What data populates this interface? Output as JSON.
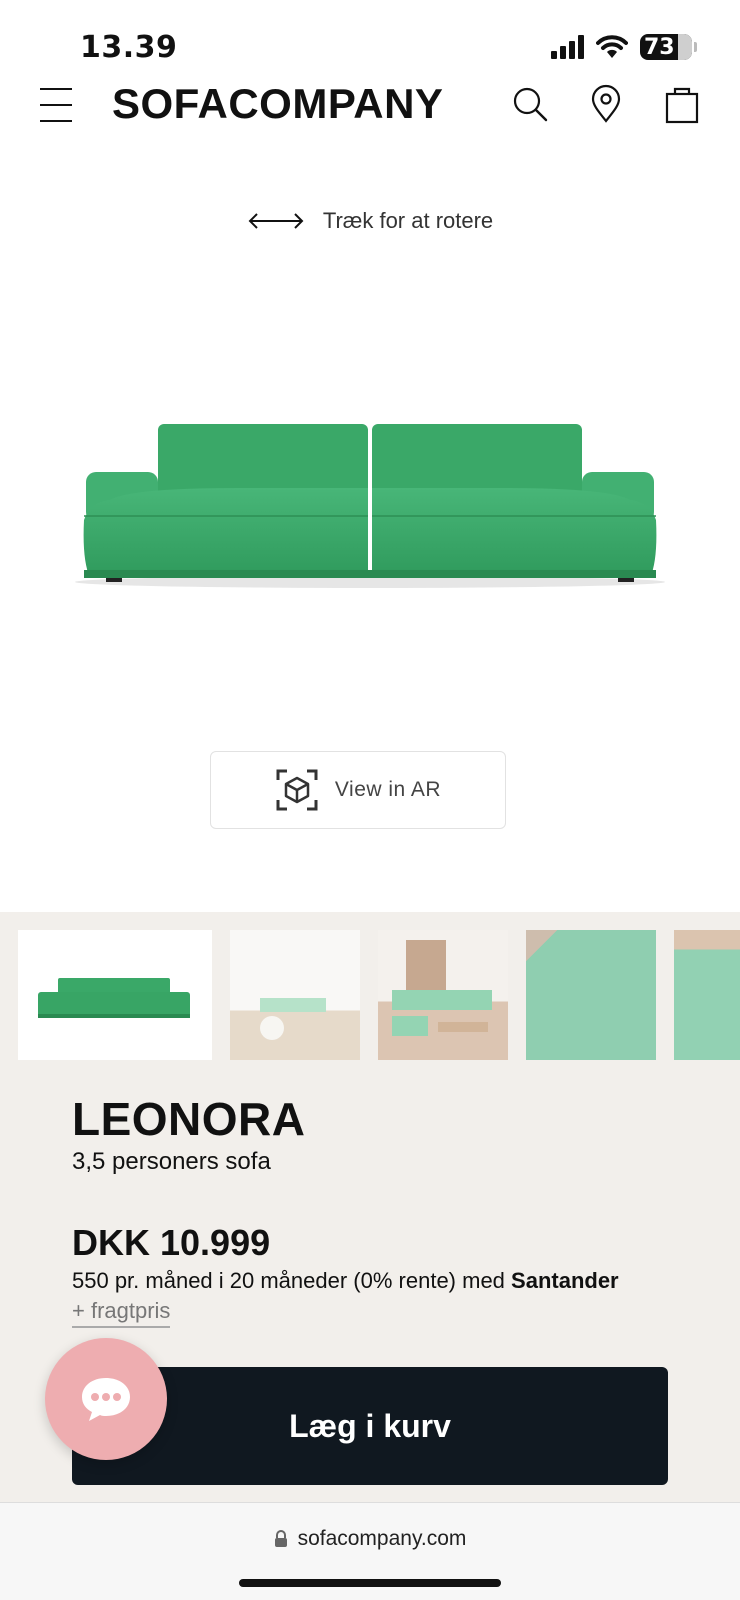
{
  "status_bar": {
    "time": "13.39",
    "battery": "73"
  },
  "header": {
    "logo": "SOFACOMPANY",
    "icons": [
      "menu-icon",
      "search-icon",
      "location-pin-icon",
      "shopping-bag-icon"
    ]
  },
  "viewer": {
    "rotate_hint": "Træk for at rotere",
    "ar_label": "View in AR",
    "sofa_color": "#3fae6e"
  },
  "gallery": {
    "thumbnails": [
      "Sofa front view",
      "Living room scene",
      "Room with shelves scene",
      "Fabric close-up",
      "Detail view"
    ]
  },
  "product": {
    "name": "LEONORA",
    "type": "3,5 personers sofa",
    "price": "DKK 10.999",
    "finance_text": "550 pr. måned i 20 måneder (0% rente) med ",
    "finance_brand": "Santander",
    "freight": "+ fragtpris",
    "add_to_cart": "Læg i kurv"
  },
  "browser": {
    "url": "sofacompany.com"
  },
  "colors": {
    "accent_dark": "#101820",
    "beige": "#f2efeb",
    "chat_pink": "#eeadb0",
    "sofa_green": "#3fae6e"
  }
}
